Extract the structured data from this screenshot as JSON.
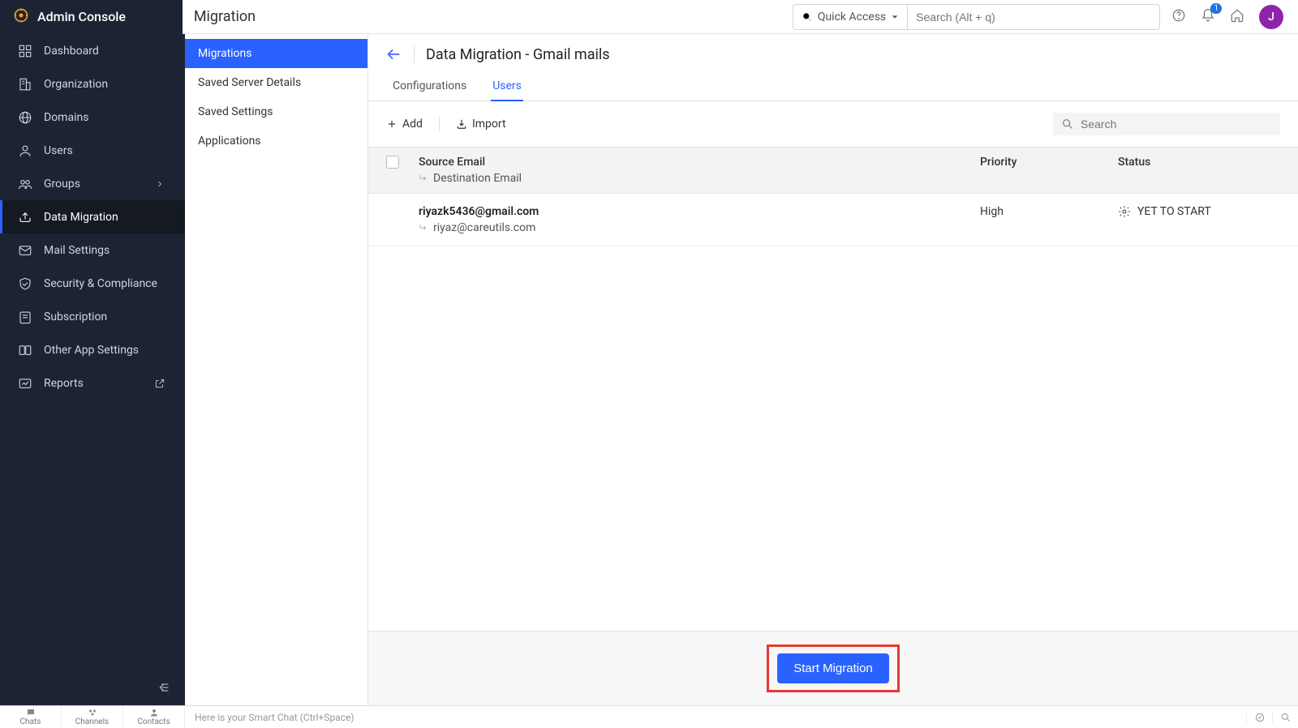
{
  "brand": "Admin Console",
  "section_title": "Migration",
  "quick_access_label": "Quick Access",
  "global_search_placeholder": "Search (Alt + q)",
  "notification_count": "1",
  "avatar_initial": "J",
  "nav1": {
    "items": [
      {
        "label": "Dashboard"
      },
      {
        "label": "Organization"
      },
      {
        "label": "Domains"
      },
      {
        "label": "Users"
      },
      {
        "label": "Groups"
      },
      {
        "label": "Data Migration"
      },
      {
        "label": "Mail Settings"
      },
      {
        "label": "Security & Compliance"
      },
      {
        "label": "Subscription"
      },
      {
        "label": "Other App Settings"
      },
      {
        "label": "Reports"
      }
    ]
  },
  "nav2": {
    "items": [
      {
        "label": "Migrations"
      },
      {
        "label": "Saved Server Details"
      },
      {
        "label": "Saved Settings"
      },
      {
        "label": "Applications"
      }
    ]
  },
  "page": {
    "title": "Data Migration - Gmail mails",
    "tabs": [
      {
        "label": "Configurations"
      },
      {
        "label": "Users"
      }
    ],
    "toolbar": {
      "add_label": "Add",
      "import_label": "Import",
      "search_placeholder": "Search"
    },
    "columns": {
      "source": "Source Email",
      "destination": "Destination Email",
      "priority": "Priority",
      "status": "Status"
    },
    "rows": [
      {
        "source_email": "riyazk5436@gmail.com",
        "destination_email": "riyaz@careutils.com",
        "priority": "High",
        "status": "YET TO START"
      }
    ],
    "start_button": "Start Migration"
  },
  "statusbar": {
    "chats": "Chats",
    "channels": "Channels",
    "contacts": "Contacts",
    "smart_chat": "Here is your Smart Chat (Ctrl+Space)"
  }
}
